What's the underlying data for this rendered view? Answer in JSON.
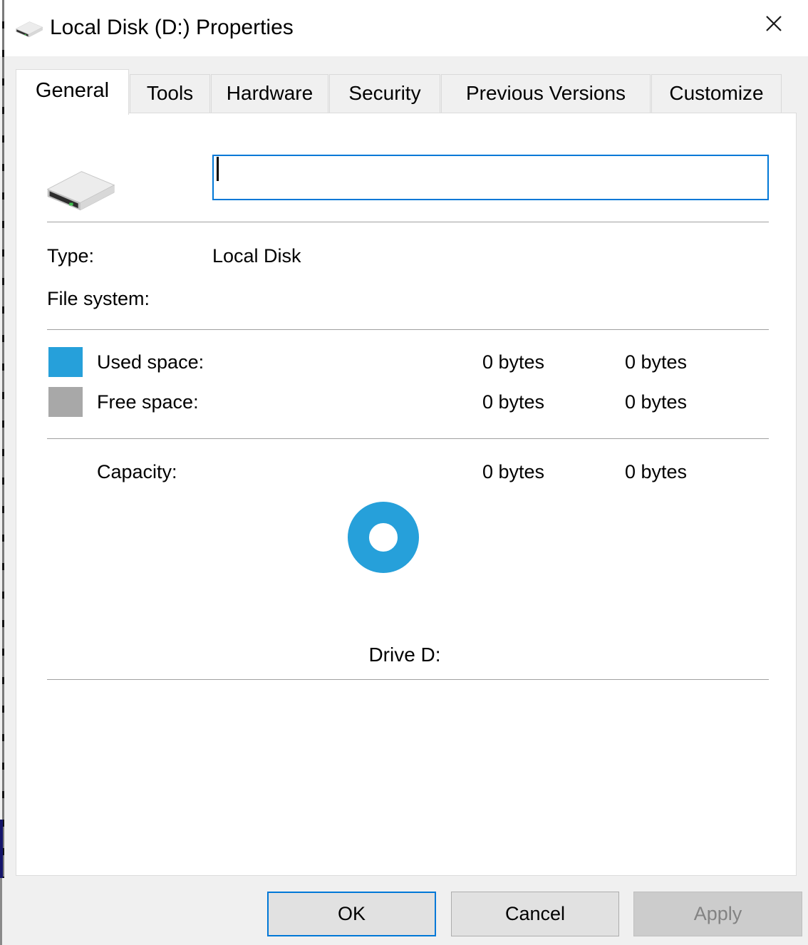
{
  "window": {
    "title": "Local Disk (D:) Properties"
  },
  "tabs": {
    "items": [
      {
        "label": "General",
        "active": true
      },
      {
        "label": "Tools",
        "active": false
      },
      {
        "label": "Hardware",
        "active": false
      },
      {
        "label": "Security",
        "active": false
      },
      {
        "label": "Previous Versions",
        "active": false
      },
      {
        "label": "Customize",
        "active": false
      }
    ]
  },
  "general": {
    "volume_label_input": {
      "value": "",
      "placeholder": ""
    },
    "type_row": {
      "label": "Type:",
      "value": "Local Disk"
    },
    "file_system_row": {
      "label": "File system:",
      "value": ""
    },
    "used_row": {
      "label": "Used space:",
      "bytes": "0 bytes",
      "size": "0 bytes"
    },
    "free_row": {
      "label": "Free space:",
      "bytes": "0 bytes",
      "size": "0 bytes"
    },
    "capacity_row": {
      "label": "Capacity:",
      "bytes": "0 bytes",
      "size": "0 bytes"
    },
    "drive_caption": "Drive D:"
  },
  "chart_data": {
    "type": "pie",
    "title": "Drive D:",
    "segments": [
      {
        "label": "Used space",
        "value_bytes": "0 bytes",
        "value": "0 bytes",
        "color": "#26a0da"
      },
      {
        "label": "Free space",
        "value_bytes": "0 bytes",
        "value": "0 bytes",
        "color": "#a8a8a8"
      }
    ],
    "ring_rendered_color": "#26a0da"
  },
  "buttons": {
    "ok": "OK",
    "cancel": "Cancel",
    "apply": "Apply",
    "apply_disabled": true
  },
  "icons": {
    "titlebar": "hard-drive-icon",
    "close": "close-icon",
    "content": "hard-drive-icon"
  },
  "colors": {
    "accent": "#0078d7",
    "used_space": "#26a0da",
    "free_space": "#a8a8a8",
    "dialog_bg": "#f0f0f0",
    "disabled_text": "#838383"
  }
}
